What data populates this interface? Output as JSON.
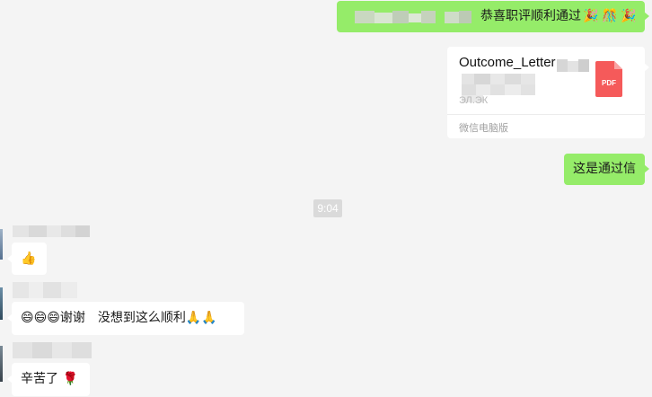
{
  "messages": {
    "out_1": {
      "text": "恭喜职评顺利通过",
      "emojis": [
        "party-popper",
        "fireworks-cracker",
        "party-popper"
      ]
    },
    "file": {
      "name": "Outcome_Letter",
      "size": "ЭЛ.ЭК",
      "source": "微信电脑版",
      "icon_label": "PDF"
    },
    "out_2": {
      "text": "这是通过信"
    },
    "time": "9:04",
    "in_1": {
      "emojis": [
        "thumbs-up"
      ]
    },
    "in_2": {
      "text": "谢谢　没想到这么顺利",
      "emojis_before": [
        "grin",
        "grin",
        "grin"
      ],
      "emojis_after": [
        "pray",
        "pray"
      ]
    },
    "in_3": {
      "text": "辛苦了",
      "emojis": [
        "rose"
      ]
    }
  },
  "colors": {
    "background": "#f4f4f4",
    "outgoing_bubble": "#95ec69",
    "incoming_bubble": "#ffffff",
    "pdf_red": "#f55a5a",
    "time_badge": "#dadada"
  }
}
